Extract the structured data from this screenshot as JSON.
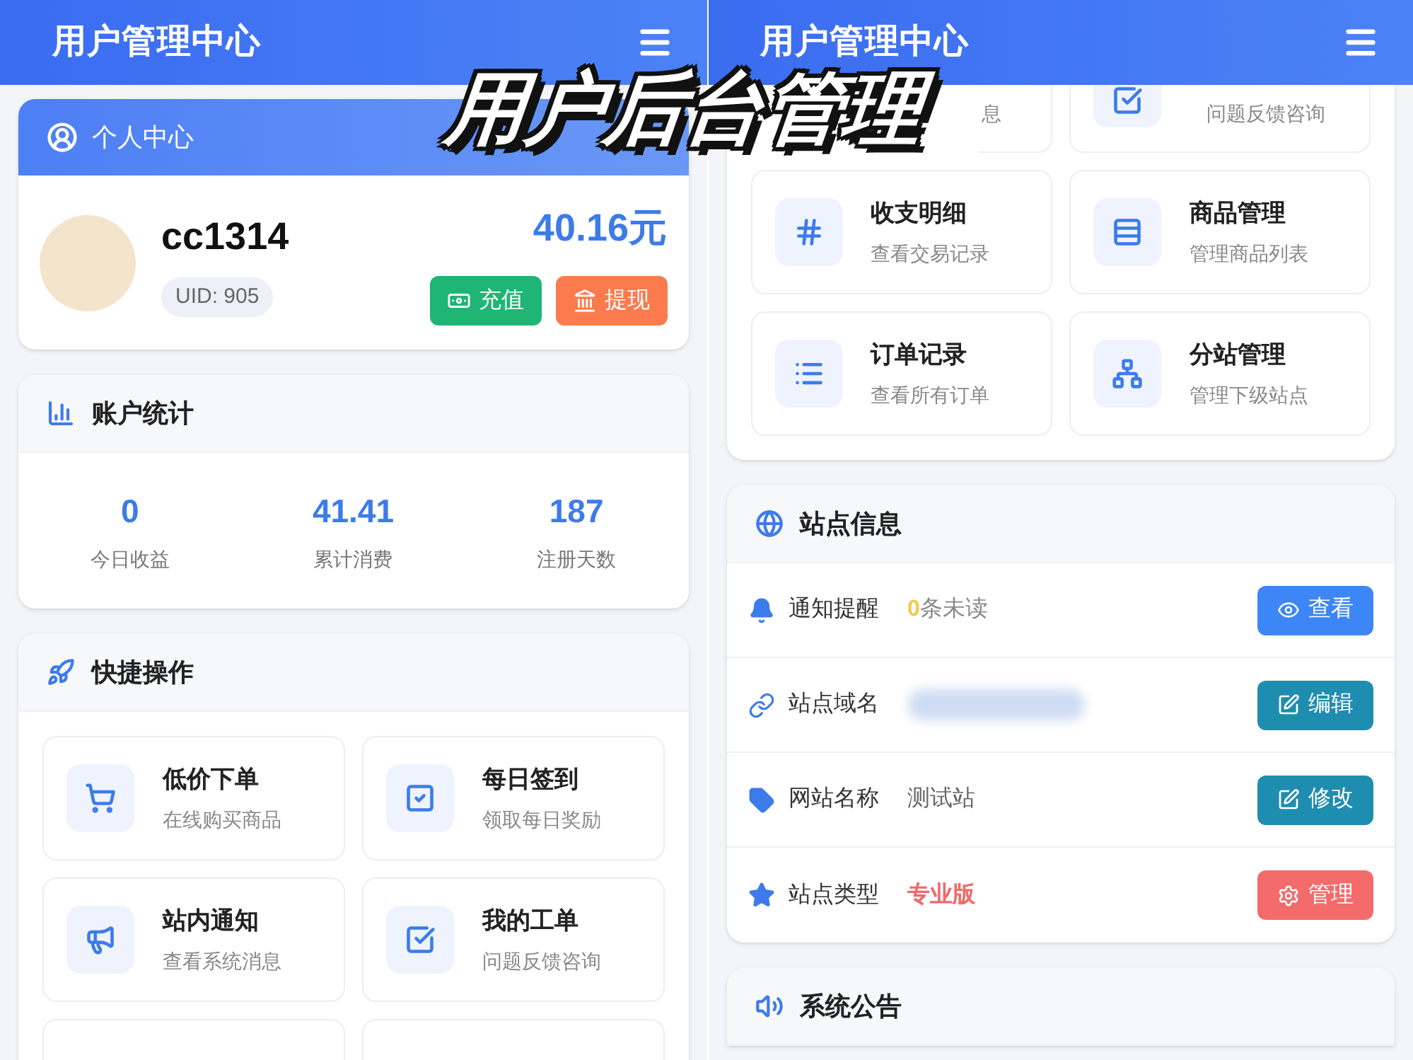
{
  "left_screen": {
    "header": {
      "title": "用户管理中心"
    },
    "profile": {
      "title": "个人中心",
      "username": "cc1314",
      "uid": "UID: 905",
      "balance": "40.16元",
      "buttons": [
        {
          "label": "充值",
          "color": "#1fb575"
        },
        {
          "label": "提现",
          "color": "#fb7b4f"
        }
      ]
    },
    "stats": {
      "title": "账户统计",
      "items": [
        {
          "value": "0",
          "label": "今日收益"
        },
        {
          "value": "41.41",
          "label": "累计消费"
        },
        {
          "value": "187",
          "label": "注册天数"
        }
      ]
    },
    "quick_actions": {
      "title": "快捷操作",
      "items": [
        {
          "title": "低价下单",
          "subtitle": "在线购买商品"
        },
        {
          "title": "每日签到",
          "subtitle": "领取每日奖励"
        },
        {
          "title": "站内通知",
          "subtitle": "查看系统消息"
        },
        {
          "title": "我的工单",
          "subtitle": "问题反馈咨询"
        }
      ]
    }
  },
  "right_screen": {
    "header": {
      "title": "用户管理中心"
    },
    "quick_actions": {
      "partial_items": [
        {
          "subtitle": "息"
        },
        {
          "subtitle": "问题反馈咨询"
        }
      ],
      "items": [
        {
          "title": "收支明细",
          "subtitle": "查看交易记录"
        },
        {
          "title": "商品管理",
          "subtitle": "管理商品列表"
        },
        {
          "title": "订单记录",
          "subtitle": "查看所有订单"
        },
        {
          "title": "分站管理",
          "subtitle": "管理下级站点"
        }
      ]
    },
    "site_info": {
      "title": "站点信息",
      "rows": [
        {
          "kind": "notice",
          "label": "通知提醒",
          "count": "0",
          "value": "条未读",
          "button": {
            "label": "查看",
            "color": "#3d86f5"
          }
        },
        {
          "kind": "blurred",
          "label": "站点域名",
          "button": {
            "label": "编辑",
            "color": "#1f8db0"
          }
        },
        {
          "kind": "text",
          "label": "网站名称",
          "value": "测试站",
          "button": {
            "label": "修改",
            "color": "#1f8db0"
          }
        },
        {
          "kind": "highlight",
          "label": "站点类型",
          "value": "专业版",
          "button": {
            "label": "管理",
            "color": "#f46b6b"
          }
        }
      ]
    },
    "announcement": {
      "title": "系统公告"
    }
  },
  "overlay_title": "用户后台管理"
}
